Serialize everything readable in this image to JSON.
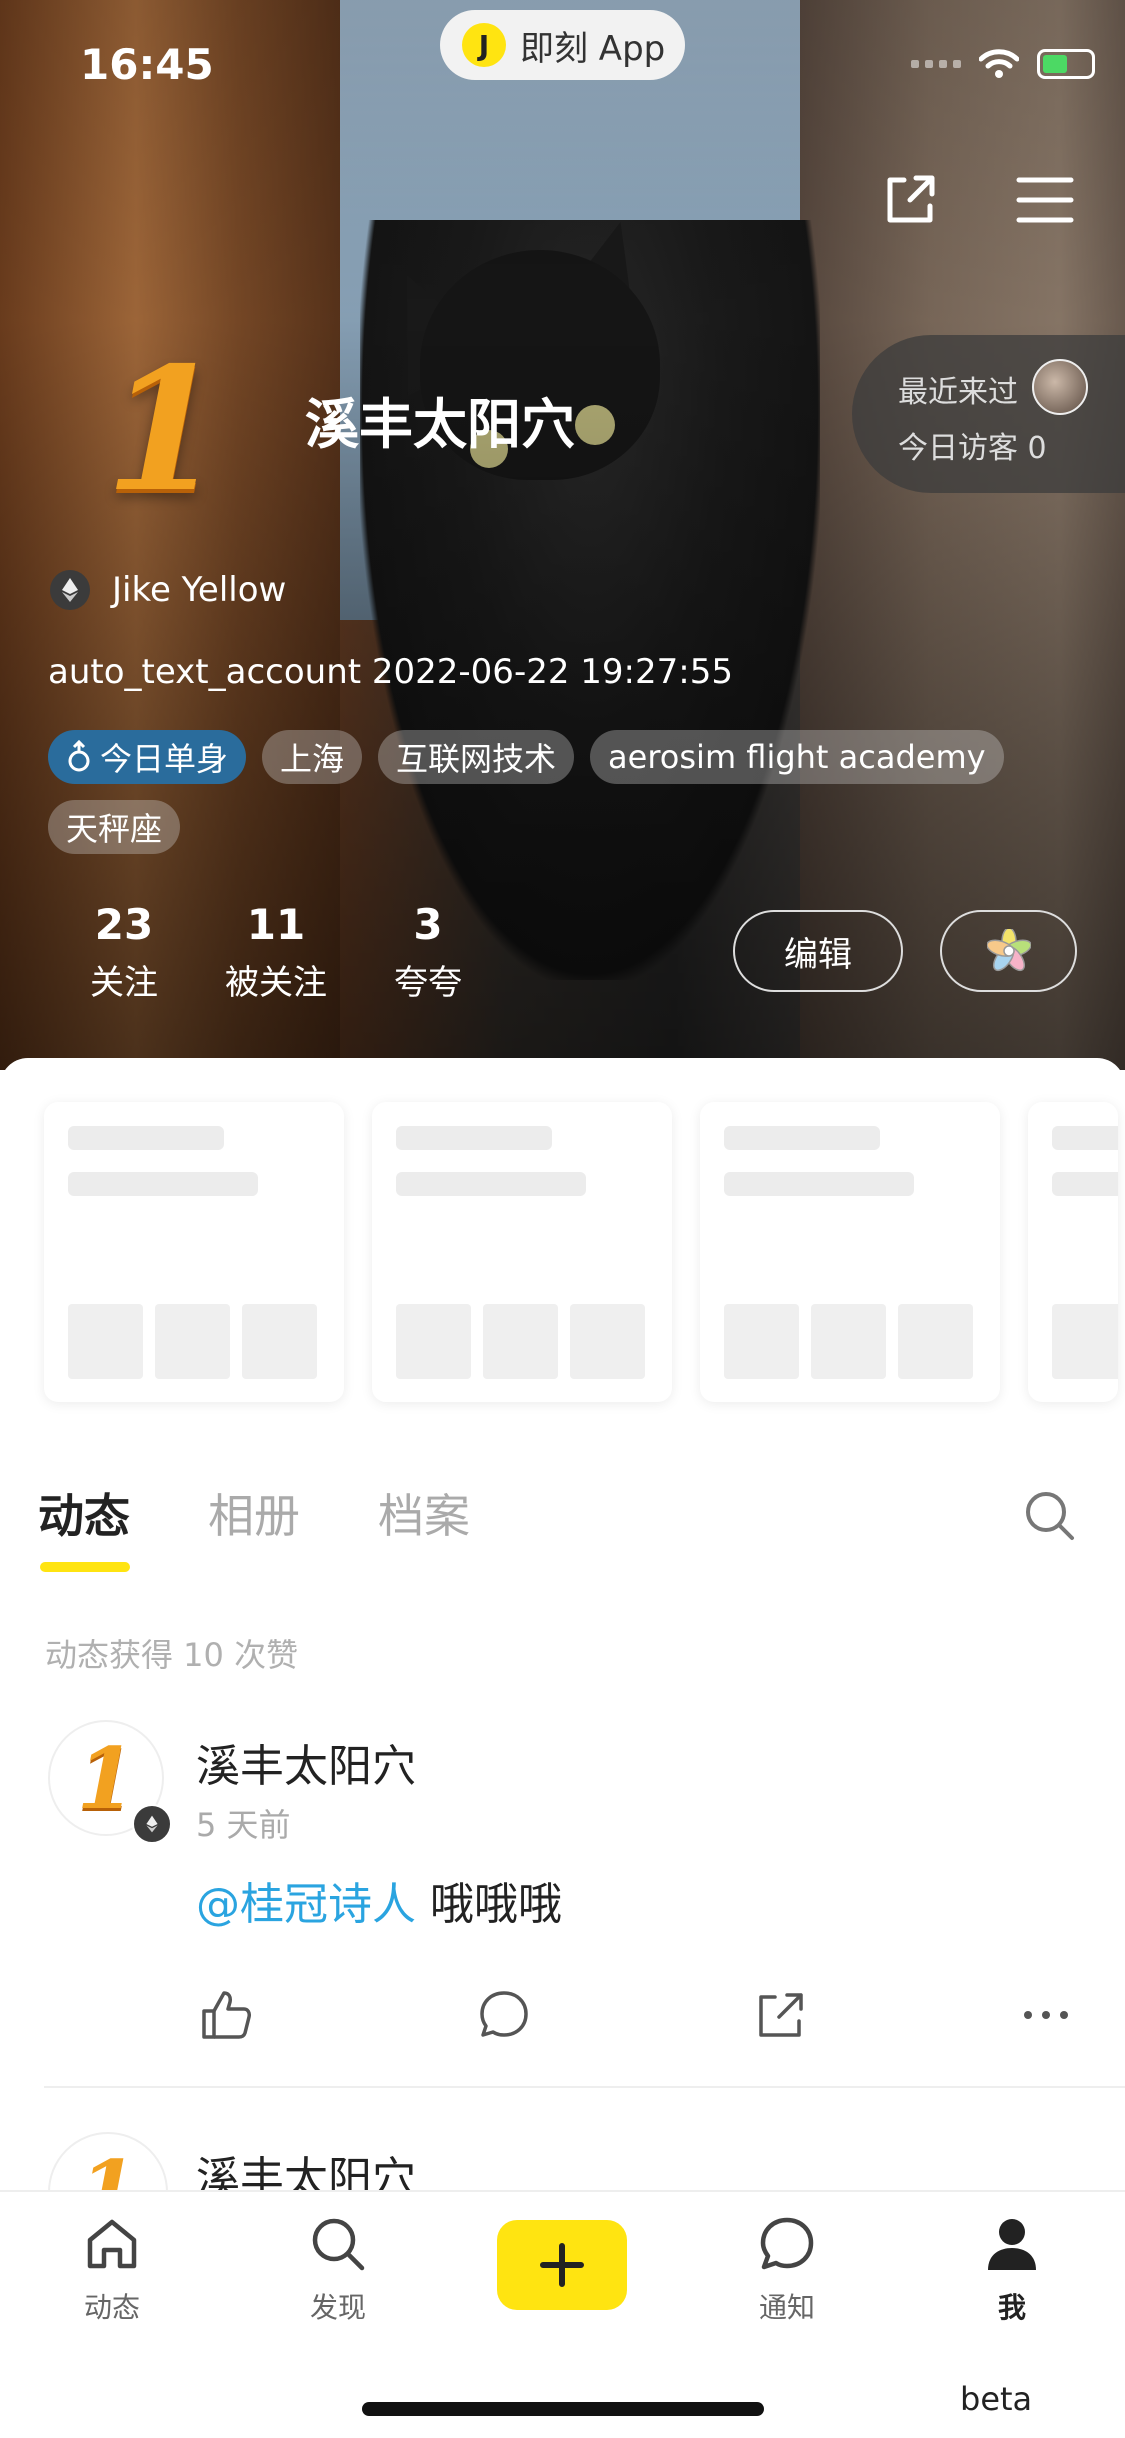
{
  "status_bar": {
    "time": "16:45"
  },
  "app_pill": {
    "logo_letter": "J",
    "label": "即刻 App"
  },
  "profile": {
    "rank_badge": "1",
    "name": "溪丰太阳穴",
    "recent_visitors_label": "最近来过",
    "today_visitors_label": "今日访客 0",
    "membership": "Jike Yellow",
    "account_meta": "auto_text_account  2022-06-22 19:27:55",
    "tags": [
      "今日单身",
      "上海",
      "互联网技术",
      "aerosim  flight academy",
      "天秤座"
    ],
    "stats": [
      {
        "value": "23",
        "label": "关注"
      },
      {
        "value": "11",
        "label": "被关注"
      },
      {
        "value": "3",
        "label": "夸夸"
      }
    ],
    "edit_label": "编辑"
  },
  "tabs": [
    "动态",
    "相册",
    "档案"
  ],
  "likes_summary": "动态获得 10 次赞",
  "posts": [
    {
      "author": "溪丰太阳穴",
      "time": "5 天前",
      "mention": "@桂冠诗人",
      "text": " 哦哦哦"
    },
    {
      "author": "溪丰太阳穴"
    }
  ],
  "bottom_nav": [
    {
      "label": "动态",
      "icon": "home-icon"
    },
    {
      "label": "发现",
      "icon": "search-icon"
    },
    {
      "label": "",
      "icon": "plus-icon"
    },
    {
      "label": "通知",
      "icon": "chat-bubble-icon"
    },
    {
      "label": "我",
      "icon": "person-icon"
    }
  ],
  "beta_label": "beta",
  "colors": {
    "accent": "#ffe411",
    "mention": "#2aa4e0",
    "single_tag": "#2a6c9c"
  }
}
